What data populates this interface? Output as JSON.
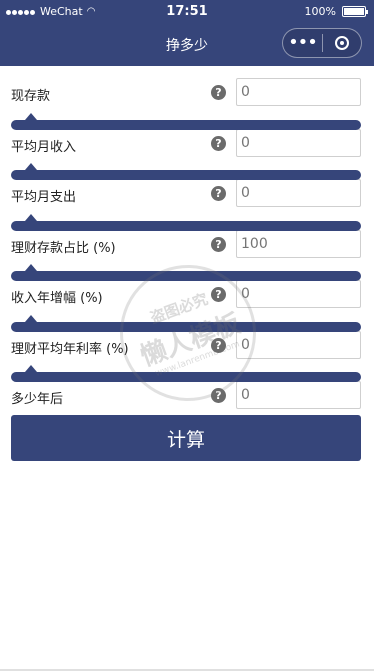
{
  "status_bar": {
    "carrier": "WeChat",
    "time": "17:51",
    "battery": "100%",
    "battery_level": 1.0
  },
  "nav": {
    "title": "挣多少",
    "more_label": "•••"
  },
  "fields": [
    {
      "label": "现存款",
      "value": "",
      "placeholder": "0",
      "has_slider": false
    },
    {
      "label": "平均月收入",
      "value": "",
      "placeholder": "0",
      "has_slider": true
    },
    {
      "label": "平均月支出",
      "value": "",
      "placeholder": "0",
      "has_slider": true
    },
    {
      "label": "理财存款占比 (%)",
      "value": "",
      "placeholder": "100",
      "has_slider": true
    },
    {
      "label": "收入年增幅 (%)",
      "value": "",
      "placeholder": "0",
      "has_slider": true
    },
    {
      "label": "理财平均年利率 (%)",
      "value": "",
      "placeholder": "0",
      "has_slider": true
    },
    {
      "label": "多少年后",
      "value": "",
      "placeholder": "0",
      "has_slider": true
    }
  ],
  "help_glyph": "?",
  "calculate_label": "计算",
  "watermark": {
    "line1": "盗图必究",
    "line2": "懒人模板",
    "line3": "www.lanrenmb.com"
  }
}
